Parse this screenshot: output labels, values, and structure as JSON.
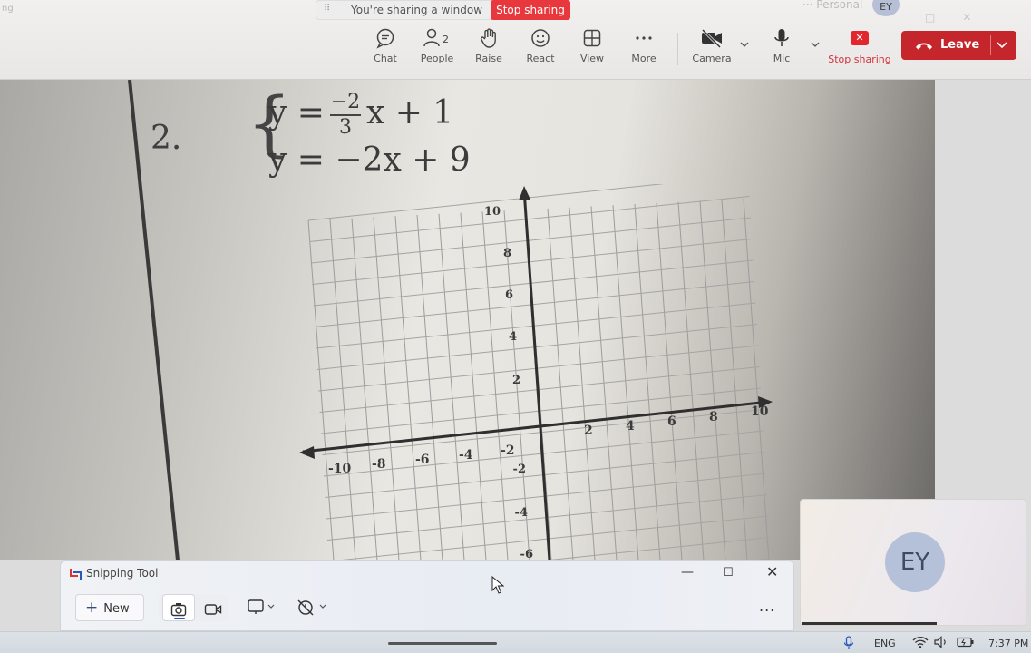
{
  "window": {
    "faint_label": "ng",
    "faint_right": "Personal",
    "top_avatar_initials": "EY"
  },
  "sharing_bar": {
    "message": "You're sharing a window",
    "stop_label": "Stop sharing"
  },
  "toolbar": {
    "chat_label": "Chat",
    "people_label": "People",
    "people_count": "2",
    "raise_label": "Raise",
    "react_label": "React",
    "view_label": "View",
    "more_label": "More",
    "camera_label": "Camera",
    "mic_label": "Mic",
    "stop_sharing_label": "Stop sharing",
    "leave_label": "Leave"
  },
  "worksheet": {
    "problem_number": "2.",
    "eq1_lhs": "y = ",
    "eq1_frac_num": "−2",
    "eq1_frac_den": "3",
    "eq1_rhs": "x + 1",
    "eq2": "y = −2x + 9",
    "x_ticks": [
      "-10",
      "-8",
      "-6",
      "-4",
      "-2",
      "2",
      "4",
      "6",
      "8",
      "10"
    ],
    "y_ticks": [
      "10",
      "8",
      "6",
      "4",
      "2",
      "-2",
      "-4",
      "-6"
    ]
  },
  "self_video": {
    "initials": "EY"
  },
  "snipping_tool": {
    "title": "Snipping Tool",
    "new_label": "New",
    "more_label": "..."
  },
  "taskbar": {
    "language": "ENG",
    "time": "7:37 PM"
  },
  "colors": {
    "leave_red": "#c4262c",
    "stop_red": "#e8383d",
    "accent_blue": "#2b58b8"
  }
}
